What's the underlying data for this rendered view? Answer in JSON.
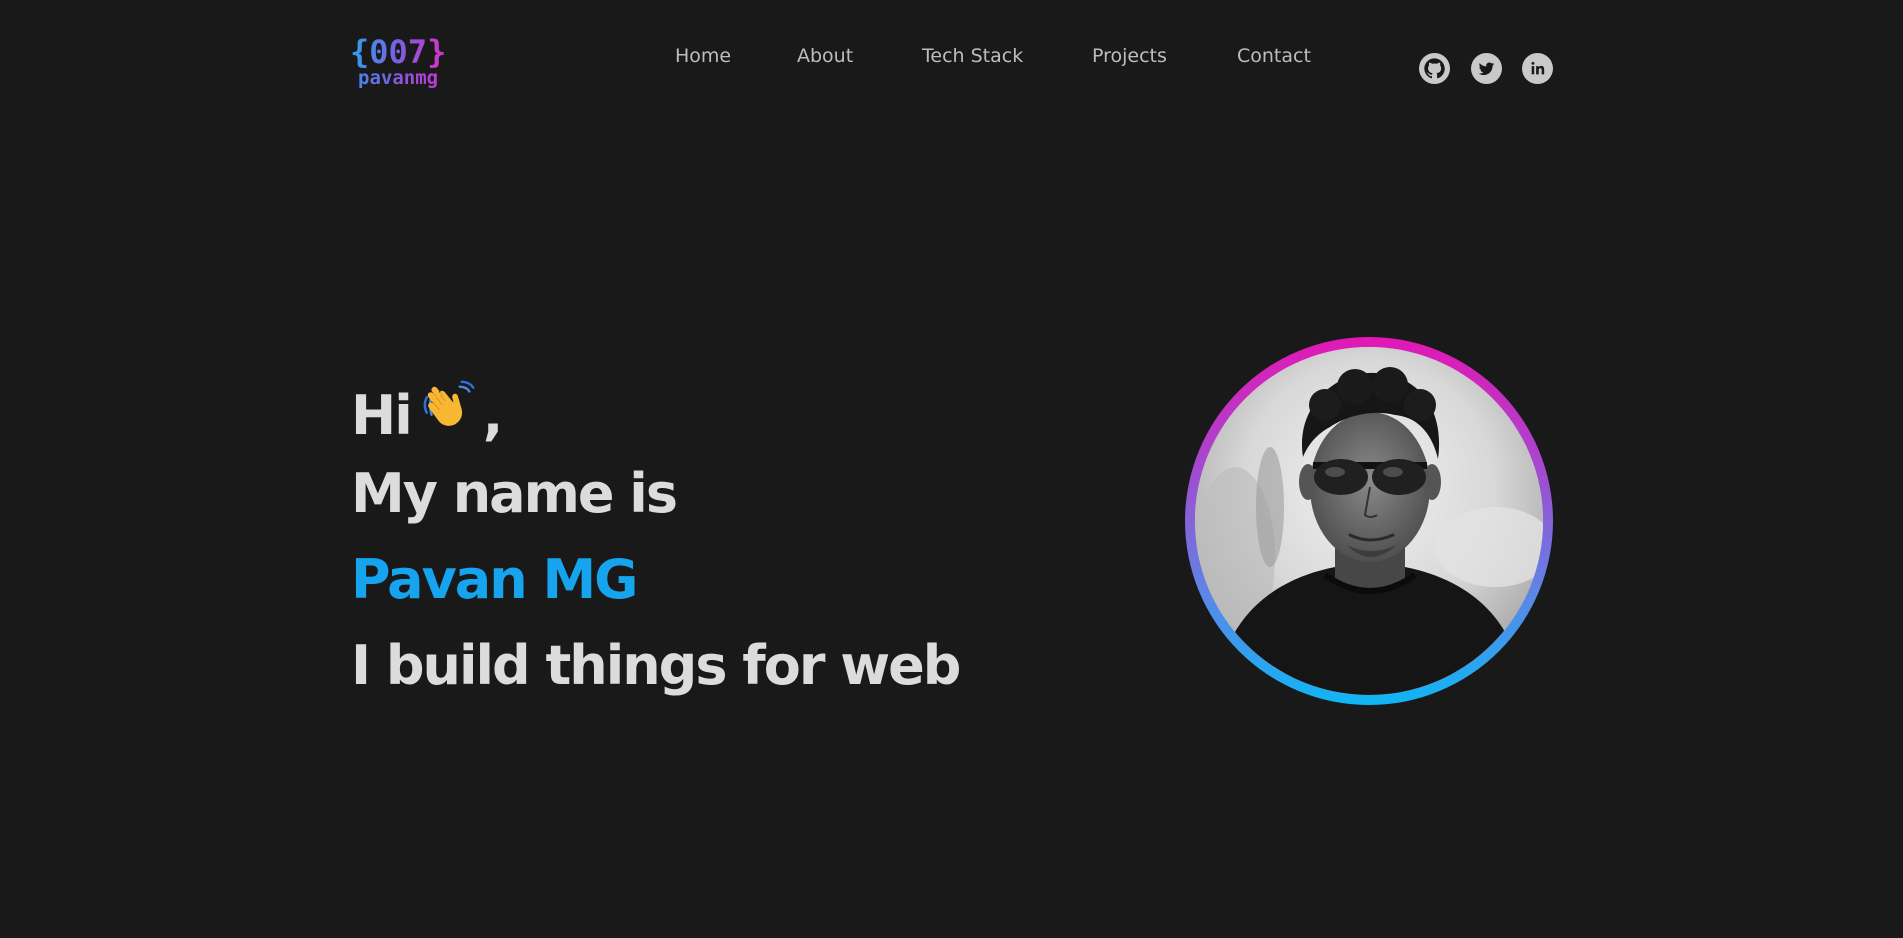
{
  "logo": {
    "top": "{007}",
    "bottom": "pavanmg"
  },
  "nav": {
    "items": [
      "Home",
      "About",
      "Tech Stack",
      "Projects",
      "Contact"
    ]
  },
  "social": {
    "icons": [
      "github-icon",
      "twitter-icon",
      "linkedin-icon"
    ]
  },
  "hero": {
    "greeting": "Hi",
    "greeting_comma": ",",
    "line2": "My name is",
    "name": "Pavan MG",
    "line4": "I build things for web"
  },
  "colors": {
    "background": "#191919",
    "text": "#dcdcdc",
    "accent": "#17a4ef",
    "nav_text": "#bdbdbd",
    "ring_top": "#e317b5",
    "ring_bottom": "#0fb6f4"
  }
}
